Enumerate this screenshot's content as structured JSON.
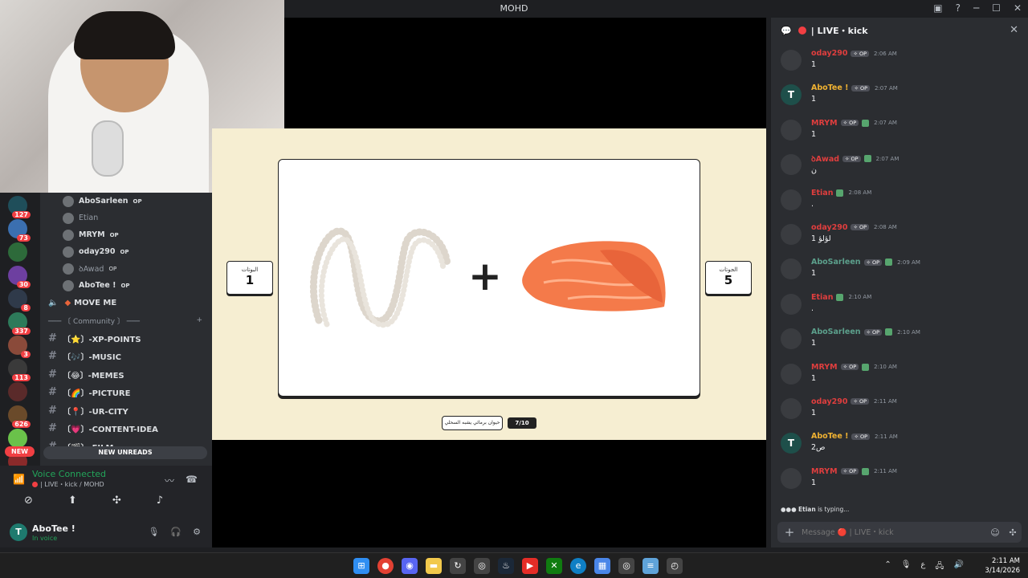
{
  "window": {
    "title": "MOHD"
  },
  "servers": {
    "badges": [
      "127",
      "73",
      "",
      "30",
      "8",
      "337",
      "3",
      "113",
      "",
      "626",
      "",
      ""
    ],
    "new_label": "NEW"
  },
  "channels": {
    "voice_users": [
      {
        "name": "AboSarleen",
        "op": "OP",
        "muted": false
      },
      {
        "name": "Etian",
        "op": "",
        "muted": true
      },
      {
        "name": "MRYM",
        "op": "OP",
        "muted": false
      },
      {
        "name": "oday290",
        "op": "OP",
        "muted": false
      },
      {
        "name": "ꝺAwad",
        "op": "OP",
        "muted": true
      },
      {
        "name": "AboTee !",
        "op": "OP",
        "muted": false
      }
    ],
    "move_me": "MOVE ME",
    "category": "─── 〔 Community 〕 ───",
    "list": [
      {
        "label": "〔⭐〕-XP-POINTS"
      },
      {
        "label": "〔🎶〕-MUSIC"
      },
      {
        "label": "〔😂〕-MEMES"
      },
      {
        "label": "〔🌈〕-PICTURE"
      },
      {
        "label": "〔📍〕-UR-CITY"
      },
      {
        "label": "〔💗〕-CONTENT-IDEA"
      },
      {
        "label": "〔🎬〕-FILM"
      }
    ],
    "new_unreads": "NEW UNREADS"
  },
  "voice": {
    "status": "Voice Connected",
    "channel": "| LIVE・kick / MOHD"
  },
  "user": {
    "name": "AboTee !",
    "status": "In voice",
    "avatar_letter": "T"
  },
  "game": {
    "left_label": "البوتات",
    "left_score": "1",
    "right_label": "الجوتات",
    "right_score": "5",
    "hint": "حيوان برمائي يشبه السحلي",
    "counter": "7/10"
  },
  "chat": {
    "title": "| LIVE・kick",
    "messages": [
      {
        "name": "oday290",
        "color": "#e03e3e",
        "op": true,
        "shield": false,
        "time": "2:06 AM",
        "text": "1"
      },
      {
        "name": "AboTee !",
        "color": "#f0b232",
        "op": true,
        "shield": false,
        "time": "2:07 AM",
        "text": "1",
        "avatar": "T"
      },
      {
        "name": "MRYM",
        "color": "#e03e3e",
        "op": true,
        "shield": true,
        "time": "2:07 AM",
        "text": "1"
      },
      {
        "name": "ꝺAwad",
        "color": "#e03e3e",
        "op": true,
        "shield": true,
        "time": "2:07 AM",
        "text": "ن"
      },
      {
        "name": "Etian",
        "color": "#e03e3e",
        "op": false,
        "shield": true,
        "time": "2:08 AM",
        "text": "."
      },
      {
        "name": "oday290",
        "color": "#e03e3e",
        "op": true,
        "shield": false,
        "time": "2:08 AM",
        "text": "1 لؤلؤ"
      },
      {
        "name": "AboSarleen",
        "color": "#5ca08c",
        "op": true,
        "shield": true,
        "time": "2:09 AM",
        "text": "1"
      },
      {
        "name": "Etian",
        "color": "#e03e3e",
        "op": false,
        "shield": true,
        "time": "2:10 AM",
        "text": "."
      },
      {
        "name": "AboSarleen",
        "color": "#5ca08c",
        "op": true,
        "shield": true,
        "time": "2:10 AM",
        "text": "1"
      },
      {
        "name": "MRYM",
        "color": "#e03e3e",
        "op": true,
        "shield": true,
        "time": "2:10 AM",
        "text": "1"
      },
      {
        "name": "oday290",
        "color": "#e03e3e",
        "op": true,
        "shield": false,
        "time": "2:11 AM",
        "text": "1"
      },
      {
        "name": "AboTee !",
        "color": "#f0b232",
        "op": true,
        "shield": false,
        "time": "2:11 AM",
        "text": "ص2",
        "avatar": "T"
      },
      {
        "name": "MRYM",
        "color": "#e03e3e",
        "op": true,
        "shield": true,
        "time": "2:11 AM",
        "text": "1"
      }
    ],
    "typing_user": "Etian",
    "typing_suffix": " is typing...",
    "placeholder": "Message 🔴 | LIVE・kick"
  },
  "taskbar": {
    "time": "2:11 AM",
    "date": "3/14/2026",
    "lang": "ع"
  }
}
